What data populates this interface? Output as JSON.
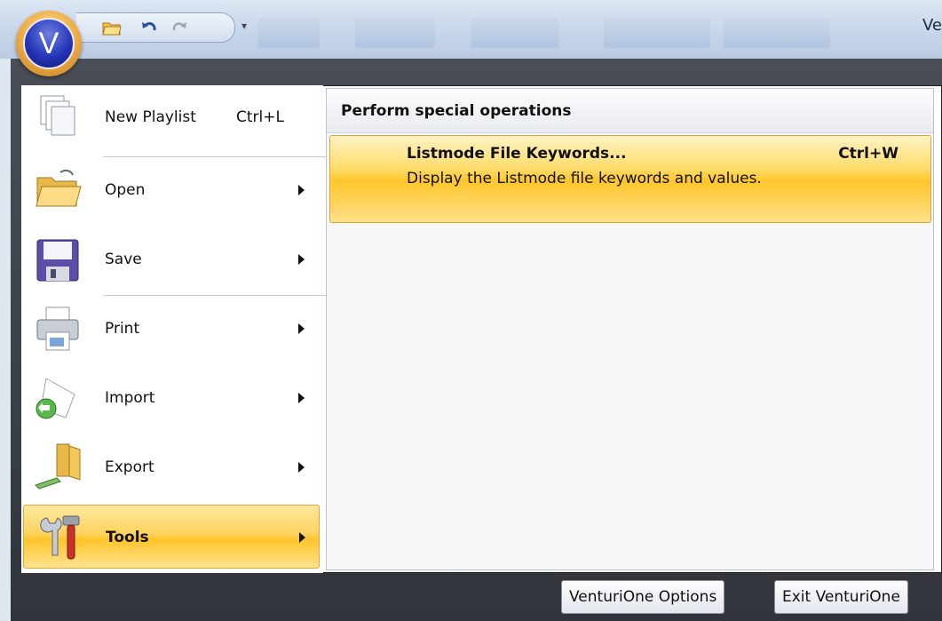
{
  "app": {
    "title_partial": "Ve"
  },
  "quick_access": {
    "icons": [
      "open-folder-icon",
      "undo-icon",
      "redo-icon",
      "customize-dropdown-icon"
    ]
  },
  "orb": {
    "letter": "V"
  },
  "left_menu": [
    {
      "label": "New Playlist",
      "shortcut": "Ctrl+L",
      "icon": "new-playlist-icon",
      "has_submenu": false
    },
    {
      "label": "Open",
      "shortcut": "",
      "icon": "open-folder-icon",
      "has_submenu": true
    },
    {
      "label": "Save",
      "shortcut": "",
      "icon": "save-disk-icon",
      "has_submenu": true
    },
    {
      "label": "Print",
      "shortcut": "",
      "icon": "printer-icon",
      "has_submenu": true
    },
    {
      "label": "Import",
      "shortcut": "",
      "icon": "import-icon",
      "has_submenu": true
    },
    {
      "label": "Export",
      "shortcut": "",
      "icon": "export-icon",
      "has_submenu": true
    },
    {
      "label": "Tools",
      "shortcut": "",
      "icon": "tools-icon",
      "has_submenu": true,
      "active": true
    }
  ],
  "submenu": {
    "heading": "Perform special operations",
    "items": [
      {
        "label": "Listmode File Keywords...",
        "shortcut": "Ctrl+W",
        "description": "Display the Listmode file keywords and values."
      }
    ]
  },
  "footer": {
    "options_label": "VenturiOne Options",
    "exit_label": "Exit VenturiOne"
  },
  "colors": {
    "highlight": "#ffc62c",
    "menu_frame": "#3a3e45",
    "orb_blue": "#2536b8"
  }
}
